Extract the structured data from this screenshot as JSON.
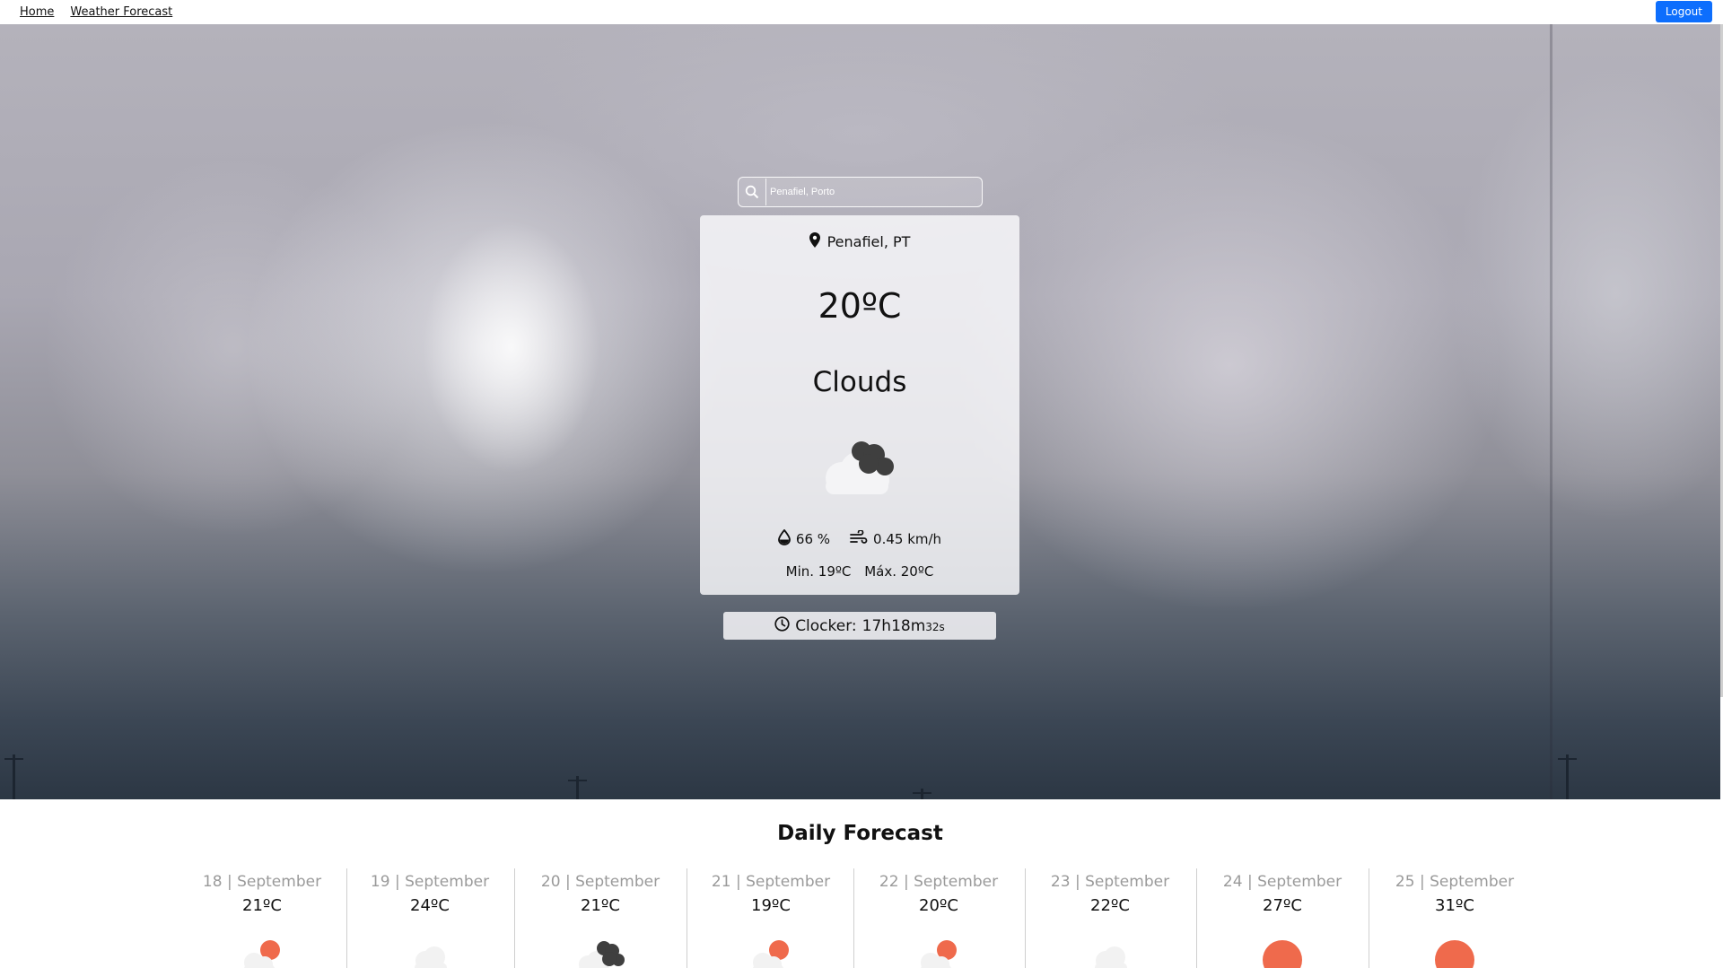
{
  "nav": {
    "home": "Home",
    "forecast": "Weather Forecast",
    "logout": "Logout"
  },
  "search": {
    "placeholder": "Penafiel, Porto",
    "value": ""
  },
  "current": {
    "location": "Penafiel, PT",
    "temperature": "20ºC",
    "condition": "Clouds",
    "icon": "clouds-icon",
    "humidity": "66 %",
    "wind": "0.45 km/h",
    "min": "Min. 19ºC",
    "max": "Máx. 20ºC"
  },
  "clock": {
    "label": "Clocker:",
    "time": "17h18m",
    "seconds": "32s"
  },
  "daily": {
    "title": "Daily Forecast",
    "days": [
      {
        "date": "18 | September",
        "temp": "21ºC",
        "icon": "partly-cloudy-icon"
      },
      {
        "date": "19 | September",
        "temp": "24ºC",
        "icon": "cloud-icon"
      },
      {
        "date": "20 | September",
        "temp": "21ºC",
        "icon": "clouds-icon"
      },
      {
        "date": "21 | September",
        "temp": "19ºC",
        "icon": "partly-cloudy-icon"
      },
      {
        "date": "22 | September",
        "temp": "20ºC",
        "icon": "partly-cloudy-icon"
      },
      {
        "date": "23 | September",
        "temp": "22ºC",
        "icon": "cloud-icon"
      },
      {
        "date": "24 | September",
        "temp": "27ºC",
        "icon": "sun-icon"
      },
      {
        "date": "25 | September",
        "temp": "31ºC",
        "icon": "sun-icon"
      }
    ]
  },
  "colors": {
    "accent": "#0d6efd",
    "sun": "#ef6a4c",
    "darkCloud": "#3f3f3f",
    "lightCloud": "#f2f2f2"
  }
}
